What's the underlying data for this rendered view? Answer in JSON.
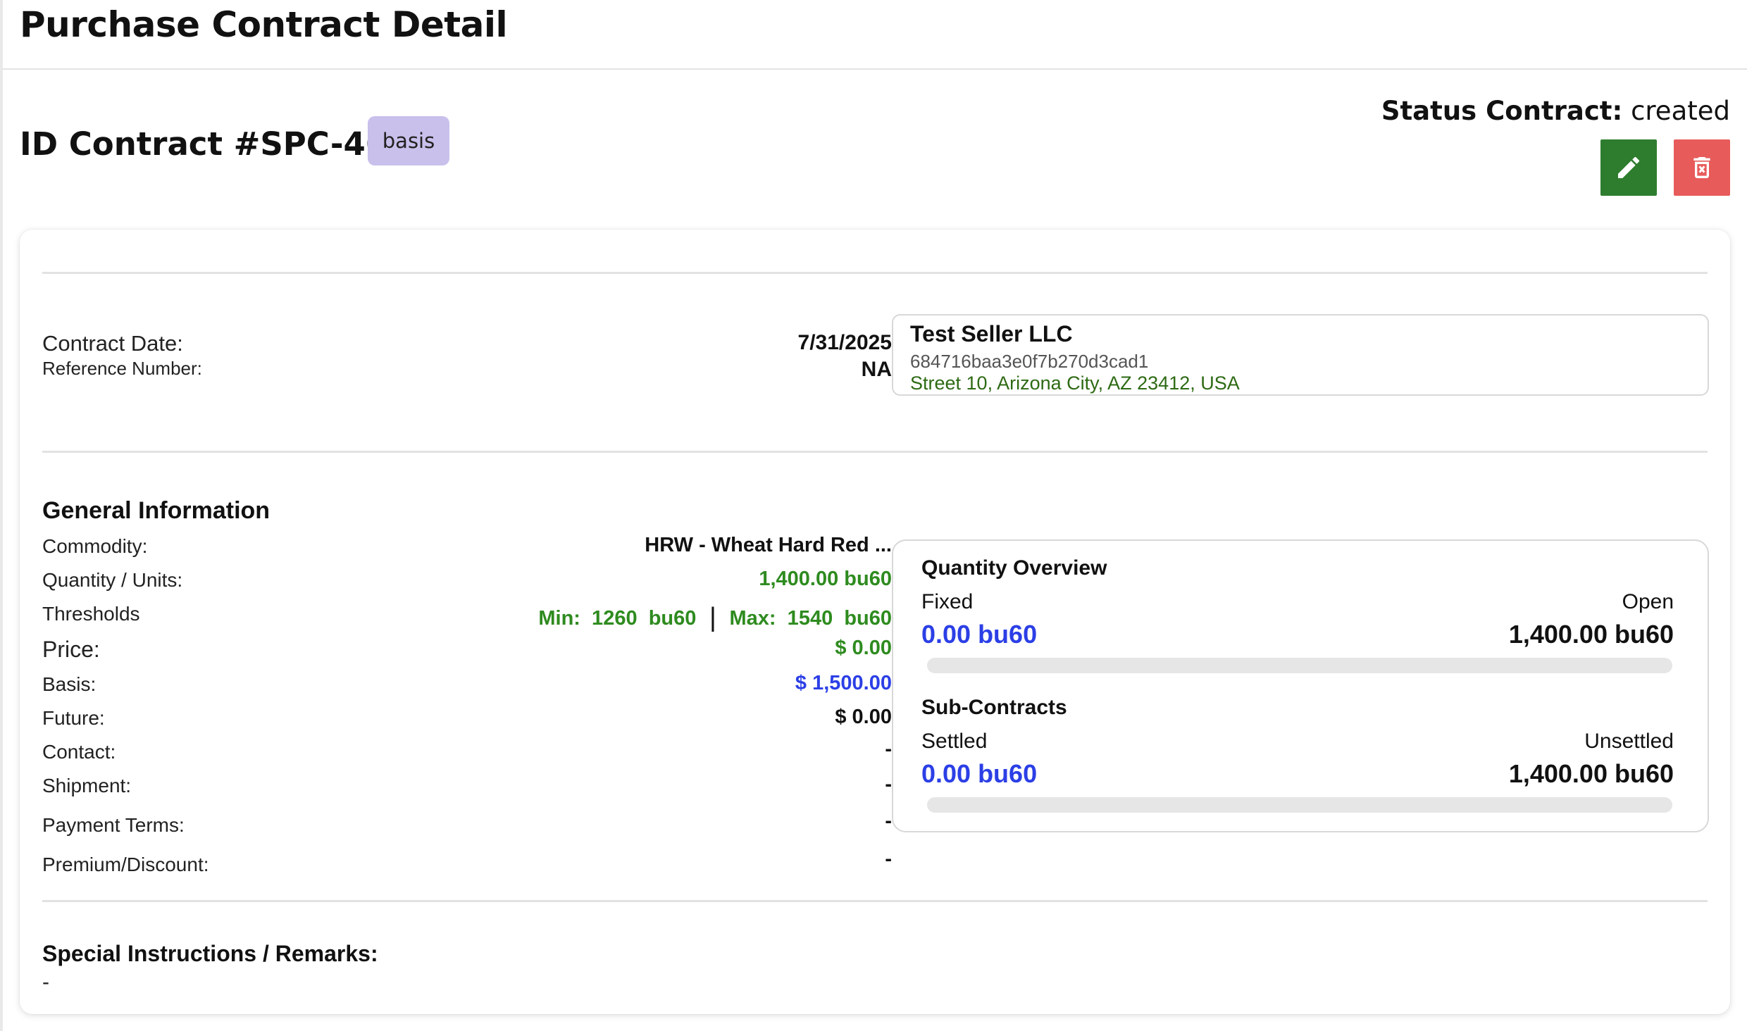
{
  "page": {
    "title": "Purchase Contract Detail"
  },
  "contract": {
    "id_label": "ID Contract #SPC-46",
    "type_badge": "basis",
    "status_label": "Status Contract:",
    "status_value": "created"
  },
  "actions": {
    "edit_icon": "pencil-icon",
    "delete_icon": "trash-icon"
  },
  "header_info": {
    "contract_date_label": "Contract Date:",
    "contract_date_value": "7/31/2025",
    "reference_label": "Reference Number:",
    "reference_value": "NA"
  },
  "seller": {
    "name": "Test Seller LLC",
    "id": "684716baa3e0f7b270d3cad1",
    "address": "Street 10, Arizona City, AZ 23412, USA"
  },
  "general": {
    "title": "General Information",
    "commodity_label": "Commodity:",
    "commodity_value": "HRW - Wheat Hard Red ...",
    "quantity_label": "Quantity / Units:",
    "quantity_value": "1,400.00 bu60",
    "thresholds_label": "Thresholds",
    "thresholds_min": "Min:  1260  bu60",
    "thresholds_max": "Max:  1540  bu60",
    "price_label": "Price:",
    "price_value": "$ 0.00",
    "basis_label": "Basis:",
    "basis_value": "$ 1,500.00",
    "future_label": "Future:",
    "future_value": "$ 0.00",
    "contact_label": "Contact:",
    "contact_value": "-",
    "shipment_label": "Shipment:",
    "shipment_value": "-",
    "payment_label": "Payment Terms:",
    "payment_value": "-",
    "premium_label": "Premium/Discount:",
    "premium_value": "-"
  },
  "quantity_overview": {
    "title": "Quantity Overview",
    "left_label": "Fixed",
    "right_label": "Open",
    "left_value": "0.00 bu60",
    "right_value": "1,400.00 bu60",
    "progress": 0
  },
  "sub_contracts": {
    "title": "Sub-Contracts",
    "left_label": "Settled",
    "right_label": "Unsettled",
    "left_value": "0.00 bu60",
    "right_value": "1,400.00 bu60",
    "progress": 0
  },
  "remarks": {
    "title": "Special Instructions / Remarks:",
    "value": "-"
  },
  "colors": {
    "edit": "#2e7d2e",
    "delete": "#e85b5b",
    "badge": "#c9c0ec",
    "accent_blue": "#2b3fe6",
    "accent_green": "#2e8b1f"
  }
}
